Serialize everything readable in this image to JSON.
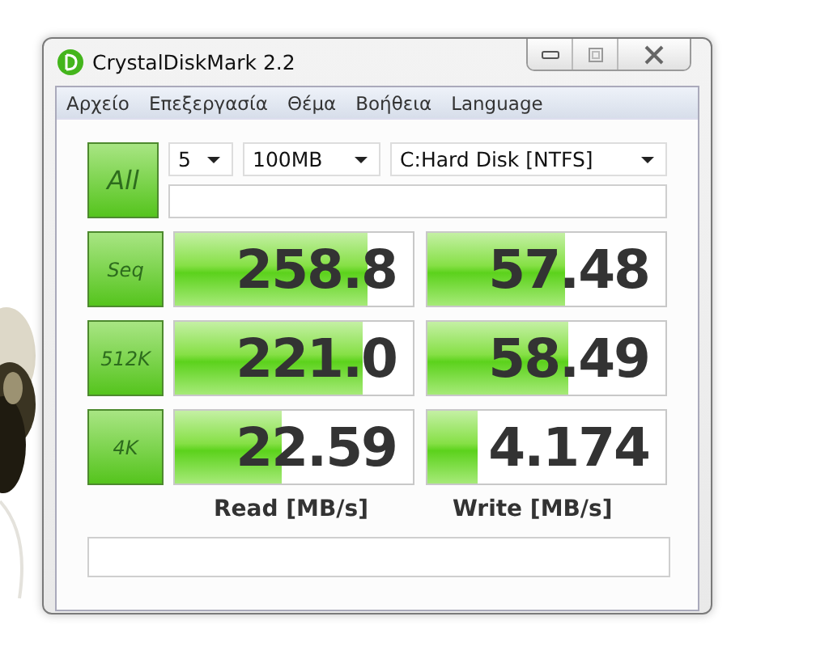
{
  "window": {
    "title": "CrystalDiskMark 2.2"
  },
  "menu": [
    "Αρχείο",
    "Επεξεργασία",
    "Θέμα",
    "Βοήθεια",
    "Language"
  ],
  "controls": {
    "all_button": "All",
    "count": "5",
    "size": "100MB",
    "drive": "C:Hard Disk [NTFS]"
  },
  "tests": [
    {
      "label": "Seq",
      "read": {
        "value": "258.8",
        "level": 0.81
      },
      "write": {
        "value": "57.48",
        "level": 0.58
      }
    },
    {
      "label": "512K",
      "read": {
        "value": "221.0",
        "level": 0.79
      },
      "write": {
        "value": "58.49",
        "level": 0.59
      }
    },
    {
      "label": "4K",
      "read": {
        "value": "22.59",
        "level": 0.45
      },
      "write": {
        "value": "4.174",
        "level": 0.21
      }
    }
  ],
  "columns": [
    "Read [MB/s]",
    "Write [MB/s]"
  ]
}
